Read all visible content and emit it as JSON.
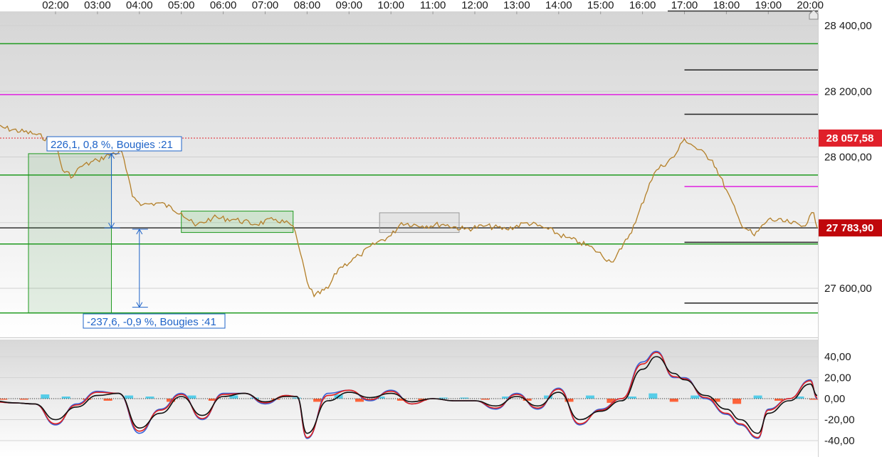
{
  "chart_data": [
    {
      "type": "line",
      "panel": "price",
      "x_tick_labels": [
        "02:00",
        "03:00",
        "04:00",
        "05:00",
        "06:00",
        "07:00",
        "08:00",
        "09:00",
        "10:00",
        "11:00",
        "12:00",
        "13:00",
        "14:00",
        "15:00",
        "16:00",
        "17:00",
        "18:00",
        "19:00",
        "20:00"
      ],
      "y_tick_labels": [
        "28 400,00",
        "28 200,00",
        "28 000,00",
        "27 600,00"
      ],
      "ylim": [
        27500,
        28440
      ],
      "series": [
        {
          "color": "#e59a1e",
          "x": [
            "00:30",
            "01:30",
            "02:00",
            "02:10",
            "02:25",
            "02:35",
            "03:00",
            "03:20",
            "03:35",
            "03:50",
            "04:05",
            "04:30",
            "05:00",
            "05:20",
            "05:45",
            "06:15",
            "06:45",
            "07:15",
            "07:40",
            "07:50",
            "08:00",
            "08:10",
            "08:30",
            "08:45",
            "09:15",
            "09:40",
            "10:00",
            "10:15",
            "10:45",
            "11:15",
            "11:45",
            "12:15",
            "12:45",
            "13:15",
            "13:45",
            "14:10",
            "14:30",
            "14:50",
            "15:15",
            "15:30",
            "15:50",
            "16:10",
            "16:20",
            "16:45",
            "17:00",
            "17:15",
            "17:40",
            "18:00",
            "18:20",
            "18:40",
            "19:00",
            "19:30",
            "19:50",
            "20:05",
            "20:10"
          ],
          "y": [
            28095,
            28070,
            28045,
            27960,
            27940,
            27970,
            27990,
            28010,
            28015,
            27880,
            27855,
            27860,
            27830,
            27790,
            27815,
            27810,
            27795,
            27810,
            27790,
            27710,
            27620,
            27575,
            27600,
            27660,
            27700,
            27740,
            27760,
            27800,
            27790,
            27795,
            27780,
            27790,
            27780,
            27800,
            27780,
            27755,
            27740,
            27720,
            27680,
            27720,
            27800,
            27920,
            27960,
            28000,
            28055,
            28030,
            27990,
            27900,
            27800,
            27760,
            27810,
            27800,
            27790,
            27830,
            27783.9
          ]
        }
      ],
      "horizontal_lines": [
        {
          "price": 28345,
          "color": "#1f9a1f",
          "from": "start"
        },
        {
          "price": 28265,
          "color": "#222222",
          "from": "17:00"
        },
        {
          "price": 28190,
          "color": "#e020e0",
          "from": "start"
        },
        {
          "price": 28130,
          "color": "#222222",
          "from": "17:00"
        },
        {
          "price": 28057.58,
          "color": "#e0202a",
          "style": "dotted",
          "from": "start"
        },
        {
          "price": 27945,
          "color": "#1f9a1f",
          "from": "start"
        },
        {
          "price": 27910,
          "color": "#e020e0",
          "from": "17:00"
        },
        {
          "price": 27783.9,
          "color": "#333333",
          "from": "start"
        },
        {
          "price": 27740,
          "color": "#222222",
          "from": "17:00"
        },
        {
          "price": 27735,
          "color": "#1f9a1f",
          "from": "start"
        },
        {
          "price": 27555,
          "color": "#222222",
          "from": "17:00"
        },
        {
          "price": 27525,
          "color": "#1f9a1f",
          "from": "start"
        }
      ],
      "price_tags": [
        {
          "label": "28 057,58",
          "price": 28057.58,
          "color": "#e0202a"
        },
        {
          "label": "27 783,90",
          "price": 27783.9,
          "color": "#c0070b"
        }
      ],
      "measurements": [
        {
          "label": "226,1, 0,8 %, Bougies :21",
          "from_x": "02:00",
          "to_x": "03:20",
          "from_y": 28010,
          "to_y": 27783.9
        },
        {
          "label": "-237,6, -0,9 %, Bougies :41",
          "from_x": "03:40",
          "to_x": "04:20",
          "from_y": 27780,
          "to_y": 27542.4
        }
      ]
    },
    {
      "type": "line",
      "panel": "oscillator",
      "y_tick_labels": [
        "40,00",
        "20,00",
        "0,00",
        "-20,00",
        "-40,00"
      ],
      "ylim": [
        -48,
        48
      ],
      "series": [
        {
          "color": "#3560d8",
          "x": [
            "00:30",
            "01:00",
            "01:30",
            "02:00",
            "02:30",
            "03:00",
            "03:30",
            "04:00",
            "04:30",
            "05:00",
            "05:30",
            "06:00",
            "06:30",
            "07:00",
            "07:30",
            "07:45",
            "08:00",
            "08:30",
            "09:00",
            "09:30",
            "10:00",
            "10:30",
            "11:00",
            "11:30",
            "12:00",
            "12:30",
            "13:00",
            "13:30",
            "14:00",
            "14:30",
            "15:00",
            "15:30",
            "16:00",
            "16:20",
            "16:45",
            "17:00",
            "17:30",
            "18:00",
            "18:20",
            "18:45",
            "19:00",
            "19:30",
            "20:00",
            "20:10"
          ],
          "y": [
            -3,
            -4,
            -5,
            -25,
            -5,
            7,
            5,
            -33,
            -10,
            5,
            -20,
            5,
            5,
            -5,
            3,
            2,
            -38,
            5,
            8,
            -2,
            8,
            -5,
            0,
            -2,
            -2,
            -10,
            5,
            -10,
            10,
            -25,
            -10,
            0,
            35,
            45,
            20,
            20,
            0,
            -15,
            -25,
            -38,
            -10,
            0,
            18,
            0
          ]
        },
        {
          "color": "#e02020",
          "x": [
            "00:30",
            "01:00",
            "01:30",
            "02:00",
            "02:30",
            "03:00",
            "03:30",
            "04:00",
            "04:30",
            "05:00",
            "05:30",
            "06:00",
            "06:30",
            "07:00",
            "07:30",
            "07:45",
            "08:00",
            "08:30",
            "09:00",
            "09:30",
            "10:00",
            "10:30",
            "11:00",
            "11:30",
            "12:00",
            "12:30",
            "13:00",
            "13:30",
            "14:00",
            "14:30",
            "15:00",
            "15:30",
            "16:00",
            "16:20",
            "16:45",
            "17:00",
            "17:30",
            "18:00",
            "18:20",
            "18:45",
            "19:00",
            "19:30",
            "20:00",
            "20:10"
          ],
          "y": [
            -3,
            -4,
            -5,
            -24,
            -6,
            6,
            5,
            -31,
            -11,
            4,
            -19,
            4,
            5,
            -4,
            3,
            2,
            -37,
            3,
            8,
            -1,
            7,
            -5,
            0,
            -2,
            -2,
            -9,
            4,
            -9,
            9,
            -24,
            -11,
            0,
            33,
            44,
            21,
            19,
            1,
            -14,
            -24,
            -37,
            -11,
            0,
            17,
            1
          ]
        },
        {
          "color": "#111111",
          "x": [
            "00:30",
            "01:00",
            "01:30",
            "02:00",
            "02:30",
            "03:00",
            "03:30",
            "04:00",
            "04:30",
            "05:00",
            "05:30",
            "06:00",
            "06:30",
            "07:00",
            "07:30",
            "07:45",
            "08:00",
            "08:30",
            "09:00",
            "09:30",
            "10:00",
            "10:30",
            "11:00",
            "11:30",
            "12:00",
            "12:30",
            "13:00",
            "13:30",
            "14:00",
            "14:30",
            "15:00",
            "15:30",
            "16:00",
            "16:20",
            "16:45",
            "17:00",
            "17:30",
            "18:00",
            "18:20",
            "18:45",
            "19:00",
            "19:30",
            "20:00",
            "20:10"
          ],
          "y": [
            -2,
            -4,
            -5,
            -20,
            -8,
            3,
            5,
            -28,
            -14,
            2,
            -16,
            2,
            5,
            -3,
            2,
            2,
            -33,
            -2,
            6,
            1,
            5,
            -3,
            0,
            -2,
            -2,
            -7,
            2,
            -7,
            6,
            -20,
            -12,
            -2,
            28,
            40,
            24,
            18,
            3,
            -10,
            -20,
            -33,
            -14,
            -2,
            14,
            3
          ]
        }
      ],
      "histogram": {
        "positive_color": "#3cc8e8",
        "negative_color": "#ff4a1a",
        "x": [
          "00:45",
          "01:15",
          "01:45",
          "02:15",
          "02:45",
          "03:15",
          "03:45",
          "04:15",
          "04:45",
          "05:15",
          "05:45",
          "06:15",
          "06:45",
          "07:15",
          "07:45",
          "08:15",
          "08:45",
          "09:15",
          "09:45",
          "10:15",
          "10:45",
          "11:15",
          "11:45",
          "12:15",
          "12:45",
          "13:15",
          "13:45",
          "14:15",
          "14:45",
          "15:15",
          "15:45",
          "16:15",
          "16:45",
          "17:15",
          "17:45",
          "18:15",
          "18:45",
          "19:15",
          "19:45",
          "20:05"
        ],
        "values": [
          -1,
          -1,
          4,
          2,
          -1,
          -2,
          3,
          2,
          -3,
          3,
          -2,
          3,
          1,
          -1,
          1,
          -3,
          4,
          -3,
          2,
          -2,
          -2,
          1,
          1,
          -1,
          2,
          -2,
          3,
          -3,
          3,
          -4,
          2,
          5,
          -3,
          3,
          -3,
          -5,
          3,
          -2,
          2,
          -1
        ]
      }
    }
  ]
}
